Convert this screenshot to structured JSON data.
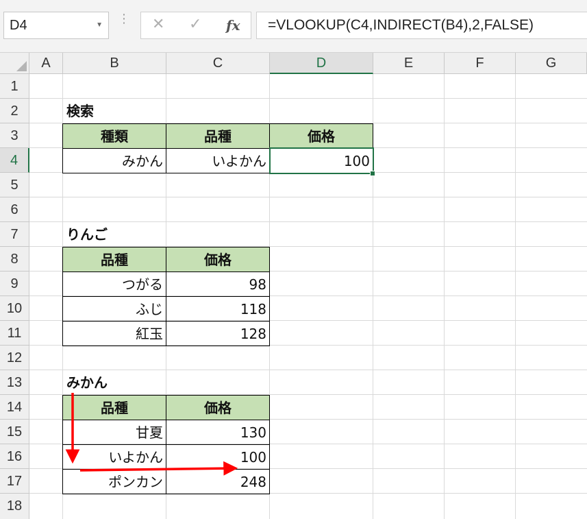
{
  "formula_bar": {
    "name_box": "D4",
    "cancel_symbol": "✕",
    "enter_symbol": "✓",
    "fx_label": "fx",
    "formula": "=VLOOKUP(C4,INDIRECT(B4),2,FALSE)"
  },
  "columns": [
    "A",
    "B",
    "C",
    "D",
    "E",
    "F",
    "G"
  ],
  "selected_column": "D",
  "rows": [
    "1",
    "2",
    "3",
    "4",
    "5",
    "6",
    "7",
    "8",
    "9",
    "10",
    "11",
    "12",
    "13",
    "14",
    "15",
    "16",
    "17",
    "18"
  ],
  "selected_row": "4",
  "search_table": {
    "title": "検索",
    "headers": [
      "種類",
      "品種",
      "価格"
    ],
    "values": [
      "みかん",
      "いよかん",
      "100"
    ]
  },
  "apple_table": {
    "title": "りんご",
    "headers": [
      "品種",
      "価格"
    ],
    "rows": [
      [
        "つがる",
        "98"
      ],
      [
        "ふじ",
        "118"
      ],
      [
        "紅玉",
        "128"
      ]
    ]
  },
  "mikan_table": {
    "title": "みかん",
    "headers": [
      "品種",
      "価格"
    ],
    "rows": [
      [
        "甘夏",
        "130"
      ],
      [
        "いよかん",
        "100"
      ],
      [
        "ポンカン",
        "248"
      ]
    ]
  },
  "colors": {
    "header_fill": "#c6e0b4",
    "selection": "#217346",
    "arrow": "#ff0000"
  }
}
